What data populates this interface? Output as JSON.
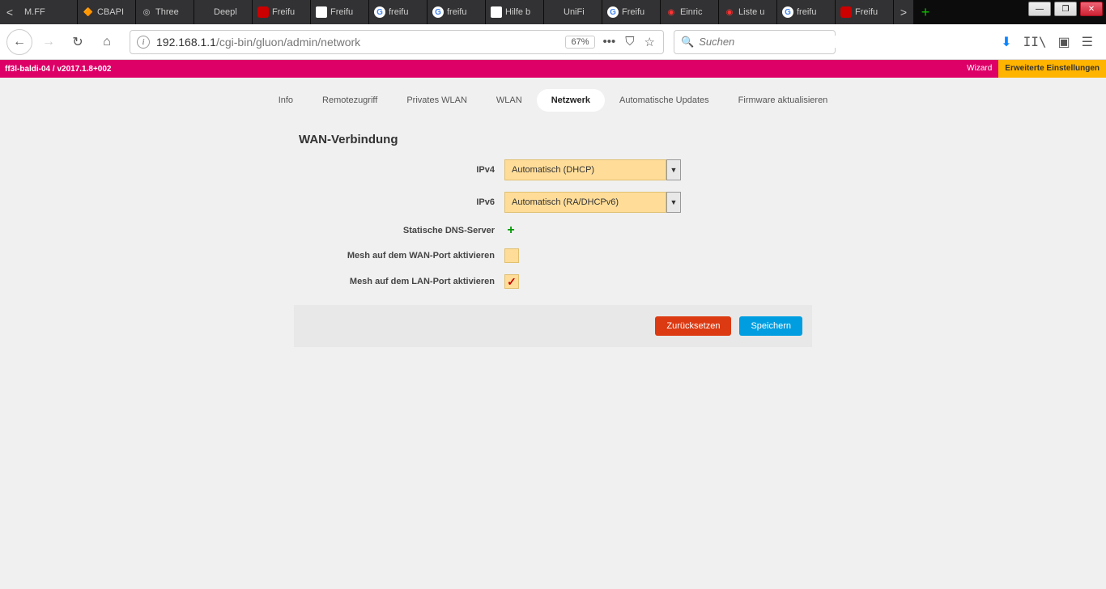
{
  "tabs": [
    "M.FF",
    "CBAPI",
    "Three",
    "Deepl",
    "Freifu",
    "Freifu",
    "freifu",
    "freifu",
    "Hilfe b",
    "UniFi",
    "Freifu",
    "Einric",
    "Liste u",
    "freifu",
    "Freifu"
  ],
  "url": {
    "host": "192.168.1.1",
    "path": "/cgi-bin/gluon/admin/network"
  },
  "zoom": "67%",
  "search_placeholder": "Suchen",
  "topbar": {
    "node": "ff3l-baldi-04 / v2017.1.8+002",
    "wizard": "Wizard",
    "advanced": "Erweiterte Einstellungen"
  },
  "menu": [
    "Info",
    "Remotezugriff",
    "Privates WLAN",
    "WLAN",
    "Netzwerk",
    "Automatische Updates",
    "Firmware aktualisieren"
  ],
  "menu_active": "Netzwerk",
  "form": {
    "title": "WAN-Verbindung",
    "ipv4_label": "IPv4",
    "ipv4_value": "Automatisch (DHCP)",
    "ipv6_label": "IPv6",
    "ipv6_value": "Automatisch (RA/DHCPv6)",
    "dns_label": "Statische DNS-Server",
    "mesh_wan_label": "Mesh auf dem WAN-Port aktivieren",
    "mesh_wan_checked": false,
    "mesh_lan_label": "Mesh auf dem LAN-Port aktivieren",
    "mesh_lan_checked": true,
    "reset": "Zurücksetzen",
    "save": "Speichern"
  }
}
